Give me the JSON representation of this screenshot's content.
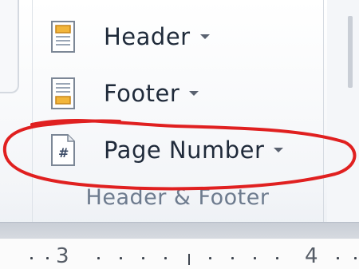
{
  "ribbon": {
    "buttons": [
      {
        "label": "Header",
        "icon": "header-page-icon"
      },
      {
        "label": "Footer",
        "icon": "footer-page-icon"
      },
      {
        "label": "Page Number",
        "icon": "page-number-icon"
      }
    ],
    "group_label": "Header & Footer"
  },
  "ruler": {
    "numbers": [
      "3",
      "4"
    ]
  },
  "colors": {
    "annotation": "#e02020",
    "text": "#1f2a3a",
    "group_label": "#6d7b8e"
  }
}
